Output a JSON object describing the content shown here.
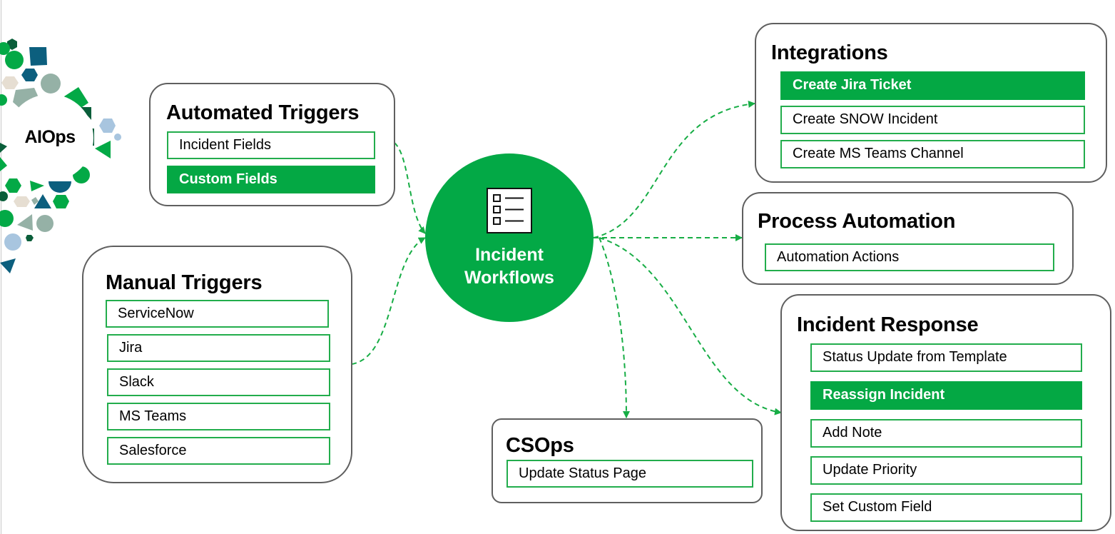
{
  "colors": {
    "brand_green": "#04a844",
    "item_border": "#22ad4c",
    "group_border": "#5f5f5f",
    "connector": "#17ad45",
    "decor_palette": [
      "#03a946",
      "#0a5e3a",
      "#0c5f7e",
      "#95b1a6",
      "#e6ded2",
      "#a8c5df"
    ]
  },
  "aiops": {
    "label": "AIOps"
  },
  "hub": {
    "label": "Incident\nWorkflows",
    "icon": "checklist-icon"
  },
  "groups": {
    "automated_triggers": {
      "title": "Automated Triggers",
      "items": [
        {
          "label": "Incident Fields",
          "highlighted": false
        },
        {
          "label": "Custom Fields",
          "highlighted": true
        }
      ]
    },
    "manual_triggers": {
      "title": "Manual Triggers",
      "items": [
        {
          "label": "ServiceNow",
          "highlighted": false
        },
        {
          "label": "Jira",
          "highlighted": false
        },
        {
          "label": "Slack",
          "highlighted": false
        },
        {
          "label": "MS Teams",
          "highlighted": false
        },
        {
          "label": "Salesforce",
          "highlighted": false
        }
      ]
    },
    "integrations": {
      "title": "Integrations",
      "items": [
        {
          "label": "Create Jira Ticket",
          "highlighted": true
        },
        {
          "label": "Create SNOW Incident",
          "highlighted": false
        },
        {
          "label": "Create MS Teams Channel",
          "highlighted": false
        }
      ]
    },
    "process_automation": {
      "title": "Process Automation",
      "items": [
        {
          "label": "Automation Actions",
          "highlighted": false
        }
      ]
    },
    "incident_response": {
      "title": "Incident Response",
      "items": [
        {
          "label": "Status Update from Template",
          "highlighted": false
        },
        {
          "label": "Reassign Incident",
          "highlighted": true
        },
        {
          "label": "Add Note",
          "highlighted": false
        },
        {
          "label": "Update Priority",
          "highlighted": false
        },
        {
          "label": "Set Custom Field",
          "highlighted": false
        }
      ]
    },
    "csops": {
      "title": "CSOps",
      "items": [
        {
          "label": "Update Status Page",
          "highlighted": false
        }
      ]
    }
  },
  "connectors": [
    {
      "from": "automated_triggers",
      "to": "hub"
    },
    {
      "from": "manual_triggers",
      "to": "hub"
    },
    {
      "from": "hub",
      "to": "integrations"
    },
    {
      "from": "hub",
      "to": "process_automation"
    },
    {
      "from": "hub",
      "to": "csops"
    },
    {
      "from": "hub",
      "to": "incident_response"
    }
  ]
}
